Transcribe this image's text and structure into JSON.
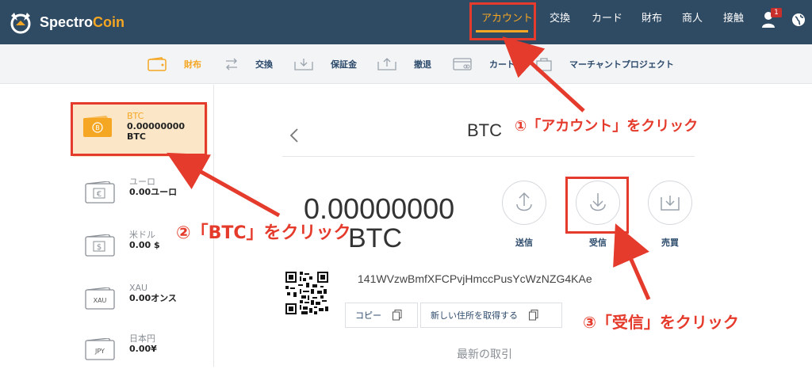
{
  "brand": {
    "name_part1": "Spectro",
    "name_part2": "Coin"
  },
  "topnav": {
    "items": [
      {
        "label": "アカウント",
        "active": true
      },
      {
        "label": "交換"
      },
      {
        "label": "カード"
      },
      {
        "label": "財布"
      },
      {
        "label": "商人"
      },
      {
        "label": "接触"
      }
    ],
    "notification_count": "1"
  },
  "subnav": {
    "items": [
      {
        "label": "財布",
        "icon": "wallet-icon",
        "active": true
      },
      {
        "label": "交換",
        "icon": "exchange-icon"
      },
      {
        "label": "保証金",
        "icon": "deposit-icon"
      },
      {
        "label": "撤退",
        "icon": "withdraw-icon"
      },
      {
        "label": "カード",
        "icon": "card-icon"
      },
      {
        "label": "マーチャントプロジェクト",
        "icon": "merchant-icon"
      }
    ]
  },
  "wallets": [
    {
      "code": "BTC",
      "balance": "0.00000000",
      "balance_unit": "BTC",
      "selected": true
    },
    {
      "code": "ユーロ",
      "balance": "0.00ユーロ"
    },
    {
      "code": "米ドル",
      "balance": "0.00 $"
    },
    {
      "code": "XAU",
      "balance": "0.00オンス"
    },
    {
      "code": "日本円",
      "balance": "0.00¥"
    }
  ],
  "main": {
    "title": "BTC",
    "balance_amount": "0.00000000",
    "balance_currency": "BTC",
    "actions": [
      {
        "label": "送信",
        "icon": "send-icon"
      },
      {
        "label": "受信",
        "icon": "receive-icon"
      },
      {
        "label": "売買",
        "icon": "trade-icon"
      }
    ],
    "address": "141WVzwBmfXFCPvjHmccPusYcWzNZG4KAe",
    "copy_label": "コピー",
    "new_address_label": "新しい住所を取得する",
    "recent_title": "最新の取引"
  },
  "annotations": {
    "step1": "①「アカウント」をクリック",
    "step2": "②「BTC」をクリック",
    "step3": "③「受信」をクリック",
    "color": "#e53b2c"
  },
  "colors": {
    "header": "#2f4a63",
    "accent": "#f5a623",
    "link": "#2c4a6b"
  }
}
